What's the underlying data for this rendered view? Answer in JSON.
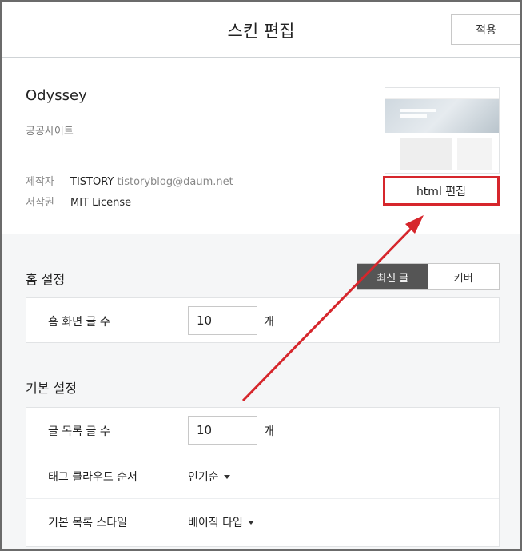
{
  "header": {
    "title": "스킨 편집",
    "apply_label": "적용"
  },
  "skin": {
    "name": "Odyssey",
    "category": "공공사이트",
    "maker_label": "제작자",
    "maker_name": "TISTORY",
    "maker_email": "tistoryblog@daum.net",
    "license_label": "저작권",
    "license_value": "MIT License",
    "html_edit_label": "html 편집"
  },
  "home_settings": {
    "title": "홈 설정",
    "toggle": [
      {
        "label": "최신 글",
        "active": true
      },
      {
        "label": "커버",
        "active": false
      }
    ],
    "post_count_label": "홈 화면 글 수",
    "post_count_value": "10",
    "post_count_unit": "개"
  },
  "basic_settings": {
    "title": "기본 설정",
    "list_count_label": "글 목록 글 수",
    "list_count_value": "10",
    "list_count_unit": "개",
    "tag_order_label": "태그 클라우드 순서",
    "tag_order_value": "인기순",
    "list_style_label": "기본 목록 스타일",
    "list_style_value": "베이직 타입"
  },
  "colors": {
    "accent_red": "#d6262c",
    "toggle_active": "#555555"
  }
}
